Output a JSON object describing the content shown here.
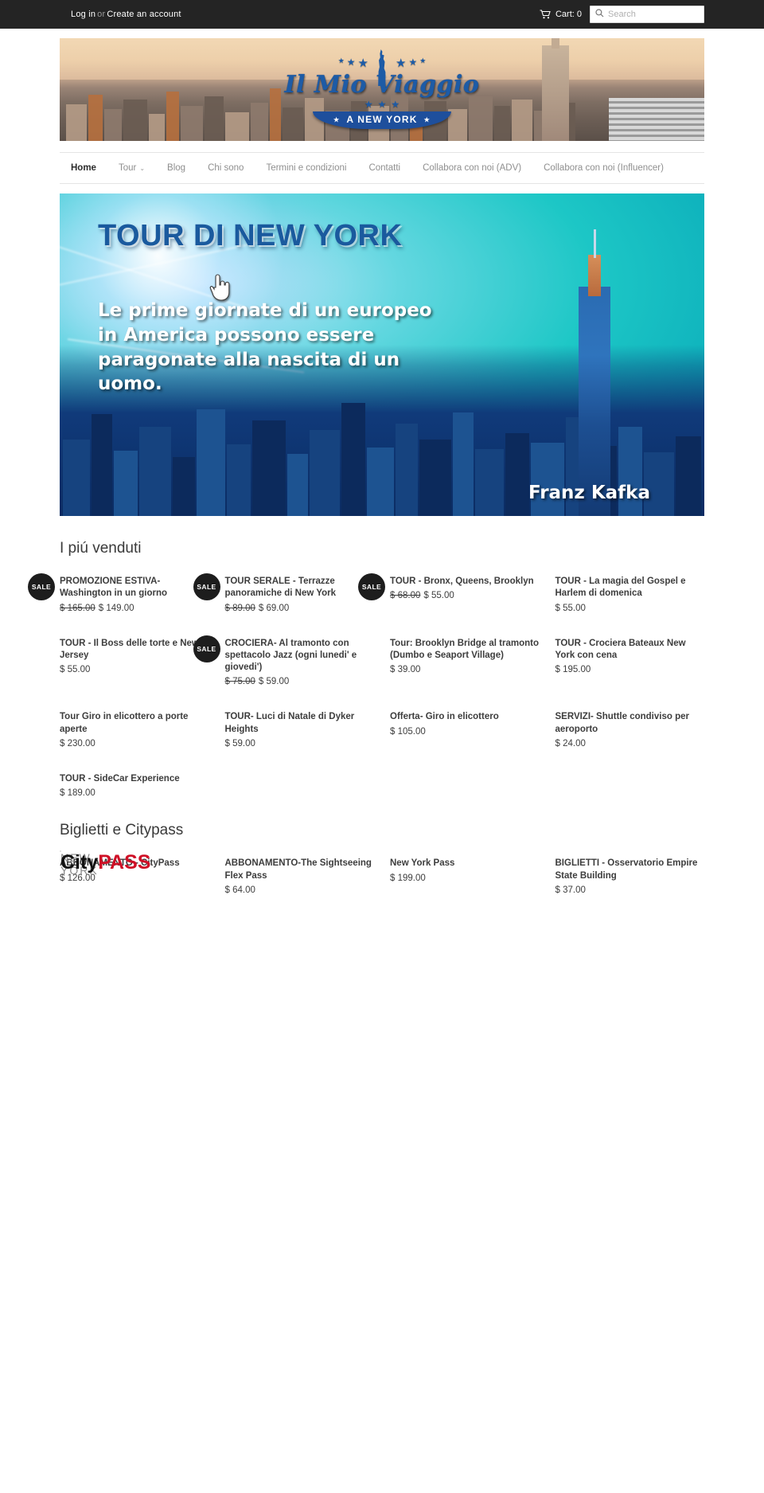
{
  "topbar": {
    "login_label": "Log in",
    "or_label": "or",
    "create_account_label": "Create an account",
    "cart_label": "Cart: 0",
    "cart_icon": "shopping-cart-icon",
    "search_icon": "search-icon",
    "search_placeholder": "Search",
    "search_value": ""
  },
  "header": {
    "logo_text": "Il Mio Viaggio",
    "ribbon_text": "A NEW YORK",
    "ribbon_star": "★",
    "liberty_icon": "statue-of-liberty-icon"
  },
  "nav": {
    "items": [
      {
        "label": "Home",
        "active": true,
        "has_dropdown": false
      },
      {
        "label": "Tour",
        "active": false,
        "has_dropdown": true
      },
      {
        "label": "Blog",
        "active": false,
        "has_dropdown": false
      },
      {
        "label": "Chi sono",
        "active": false,
        "has_dropdown": false
      },
      {
        "label": "Termini e condizioni",
        "active": false,
        "has_dropdown": false
      },
      {
        "label": "Contatti",
        "active": false,
        "has_dropdown": false
      },
      {
        "label": "Collabora con noi (ADV)",
        "active": false,
        "has_dropdown": false
      },
      {
        "label": "Collabora con noi (Influencer)",
        "active": false,
        "has_dropdown": false
      }
    ],
    "caret_icon": "chevron-down-icon"
  },
  "hero": {
    "title": "TOUR DI NEW YORK",
    "quote": "Le prime giornate di un europeo in America possono essere paragonate alla nascita di un uomo.",
    "author": "Franz Kafka",
    "cursor_icon": "pointing-hand-cursor-icon"
  },
  "sections": [
    {
      "title": "I piú venduti",
      "products": [
        {
          "title": "PROMOZIONE ESTIVA- Washington in un giorno",
          "old_price": "$ 165.00",
          "price": "$ 149.00",
          "sale": true,
          "art": "ph-whitehouse"
        },
        {
          "title": "TOUR SERALE - Terrazze panoramiche di New York",
          "old_price": "$ 89.00",
          "price": "$ 69.00",
          "sale": true,
          "art": "ph-terrace"
        },
        {
          "title": "TOUR - Bronx, Queens, Brooklyn",
          "old_price": "$ 68.00",
          "price": "$ 55.00",
          "sale": true,
          "art": "ph-bridge"
        },
        {
          "title": "TOUR - La magia del Gospel e Harlem di domenica",
          "old_price": "",
          "price": "$ 55.00",
          "sale": false,
          "art": "ph-gospel"
        },
        {
          "title": "TOUR - Il Boss delle torte e New Jersey",
          "old_price": "",
          "price": "$ 55.00",
          "sale": false,
          "art": "ph-bakery"
        },
        {
          "title": "CROCIERA- Al tramonto con spettacolo Jazz (ogni lunedi' e giovedi')",
          "old_price": "$ 75.00",
          "price": "$ 59.00",
          "sale": true,
          "art": "ph-cruise"
        },
        {
          "title": "Tour: Brooklyn Bridge al tramonto (Dumbo e Seaport Village)",
          "old_price": "",
          "price": "$ 39.00",
          "sale": false,
          "art": "ph-brooklyn"
        },
        {
          "title": "TOUR - Crociera Bateaux New York con cena",
          "old_price": "",
          "price": "$ 195.00",
          "sale": false,
          "art": "ph-bateaux"
        },
        {
          "title": "Tour Giro in elicottero a porte aperte",
          "old_price": "",
          "price": "$ 230.00",
          "sale": false,
          "art": "ph-heli"
        },
        {
          "title": "TOUR- Luci di Natale di Dyker Heights",
          "old_price": "",
          "price": "$ 59.00",
          "sale": false,
          "art": "ph-lights"
        },
        {
          "title": "Offerta- Giro in elicottero",
          "old_price": "",
          "price": "$ 105.00",
          "sale": false,
          "art": "ph-heli2"
        },
        {
          "title": "SERVIZI- Shuttle condiviso per aeroporto",
          "old_price": "",
          "price": "$ 24.00",
          "sale": false,
          "art": "ph-shuttle"
        },
        {
          "title": "TOUR - SideCar Experience",
          "old_price": "",
          "price": "$ 189.00",
          "sale": false,
          "art": "ph-sidecar"
        }
      ]
    },
    {
      "title": "Biglietti e Citypass",
      "products": [
        {
          "title": "ABBONAMENTO - CityPass",
          "old_price": "",
          "price": "$ 126.00",
          "sale": false,
          "art": "ph-citypass"
        },
        {
          "title": "ABBONAMENTO-The Sightseeing Flex Pass",
          "old_price": "",
          "price": "$ 64.00",
          "sale": false,
          "art": "ph-flex"
        },
        {
          "title": "New York Pass",
          "old_price": "",
          "price": "$ 199.00",
          "sale": false,
          "art": "ph-nypass"
        },
        {
          "title": "BIGLIETTI - Osservatorio Empire State Building",
          "old_price": "",
          "price": "$ 37.00",
          "sale": false,
          "art": "ph-esb"
        },
        {
          "title": "",
          "old_price": "",
          "price": "",
          "sale": false,
          "art": "ph-blue"
        },
        {
          "title": "",
          "old_price": "",
          "price": "",
          "sale": false,
          "art": "ph-sea"
        },
        {
          "title": "",
          "old_price": "",
          "price": "",
          "sale": false,
          "art": "ph-red"
        },
        {
          "title": "",
          "old_price": "",
          "price": "",
          "sale": false,
          "art": "ph-misc"
        }
      ]
    }
  ],
  "citypass_logo": {
    "line1": "NEW YORK",
    "line2a": "City",
    "line2b": "PASS"
  },
  "colors": {
    "topbar_bg": "#242424",
    "brand_blue": "#1d5ba6",
    "sale_badge_bg": "#1d1d1d",
    "text": "#3d3d3d"
  }
}
